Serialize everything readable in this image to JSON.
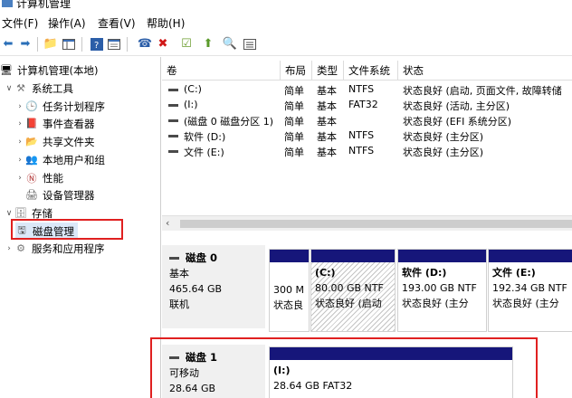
{
  "window": {
    "title": "计算机管理"
  },
  "menu": [
    "文件(F)",
    "操作(A)",
    "查看(V)",
    "帮助(H)"
  ],
  "toolbar": {
    "icons": [
      "back-arrow-icon",
      "forward-arrow-icon",
      "up-folder-icon",
      "show-hide-tree-icon",
      "help-icon",
      "properties-icon",
      "connect-icon",
      "delete-icon",
      "check-icon",
      "import-icon",
      "search-icon",
      "list-icon"
    ]
  },
  "tree": {
    "root": "计算机管理(本地)",
    "system_tools": "系统工具",
    "task_scheduler": "任务计划程序",
    "event_viewer": "事件查看器",
    "shared_folders": "共享文件夹",
    "local_users": "本地用户和组",
    "performance": "性能",
    "device_manager": "设备管理器",
    "storage": "存储",
    "disk_management": "磁盘管理",
    "services_apps": "服务和应用程序"
  },
  "volume_table": {
    "headers": [
      "卷",
      "布局",
      "类型",
      "文件系统",
      "状态"
    ],
    "rows": [
      [
        "(C:)",
        "简单",
        "基本",
        "NTFS",
        "状态良好 (启动, 页面文件, 故障转储"
      ],
      [
        "(I:)",
        "简单",
        "基本",
        "FAT32",
        "状态良好 (活动, 主分区)"
      ],
      [
        "(磁盘 0 磁盘分区 1)",
        "简单",
        "基本",
        "",
        "状态良好 (EFI 系统分区)"
      ],
      [
        "软件 (D:)",
        "简单",
        "基本",
        "NTFS",
        "状态良好 (主分区)"
      ],
      [
        "文件 (E:)",
        "简单",
        "基本",
        "NTFS",
        "状态良好 (主分区)"
      ]
    ]
  },
  "disks": [
    {
      "name": "磁盘 0",
      "type": "基本",
      "size": "465.64 GB",
      "status": "联机",
      "partitions": [
        {
          "name": "",
          "size": "300 M",
          "status": "状态良"
        },
        {
          "name": "(C:)",
          "size": "80.00 GB NTF",
          "status": "状态良好 (启动"
        },
        {
          "name": "软件  (D:)",
          "size": "193.00 GB NTF",
          "status": "状态良好 (主分"
        },
        {
          "name": "文件  (E:)",
          "size": "192.34 GB NTF",
          "status": "状态良好 (主分"
        }
      ]
    },
    {
      "name": "磁盘 1",
      "type": "可移动",
      "size": "28.64 GB",
      "partitions": [
        {
          "name": "(I:)",
          "size": "28.64 GB FAT32"
        }
      ]
    }
  ],
  "colors": {
    "partition_bar": "#16167a",
    "highlight_box": "#e02020",
    "selection": "#dbe8f8"
  }
}
